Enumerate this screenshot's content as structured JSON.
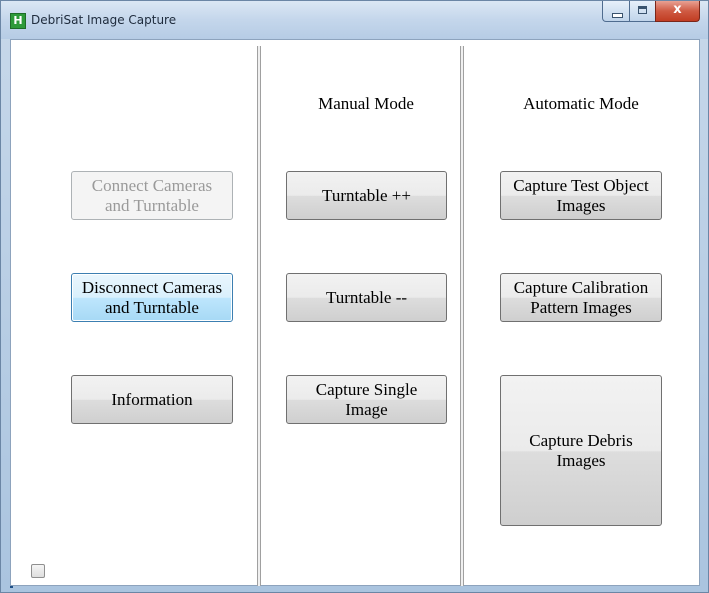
{
  "window": {
    "title": "DebriSat Image Capture",
    "app_icon_letter": "H",
    "controls": {
      "minimize": "minimize",
      "maximize": "maximize",
      "close": "x"
    }
  },
  "connection_panel": {
    "connect_button": "Connect Cameras\nand Turntable",
    "connect_enabled": false,
    "disconnect_button": "Disconnect Cameras\nand Turntable",
    "disconnect_focused": true,
    "information_button": "Information"
  },
  "manual_panel": {
    "heading": "Manual Mode",
    "turntable_up_button": "Turntable ++",
    "turntable_down_button": "Turntable --",
    "capture_single_button": "Capture Single\nImage"
  },
  "automatic_panel": {
    "heading": "Automatic Mode",
    "capture_test_object_button": "Capture Test Object\nImages",
    "capture_calibration_button": "Capture Calibration\nPattern Images",
    "capture_debris_button": "Capture Debris\nImages"
  },
  "footer": {
    "checkbox_checked": false
  },
  "colors": {
    "title_bar": "#c4d6eb",
    "close_button": "#c13c22",
    "focus_border": "#3c7fb1",
    "disabled_text": "#9a9a9a"
  }
}
